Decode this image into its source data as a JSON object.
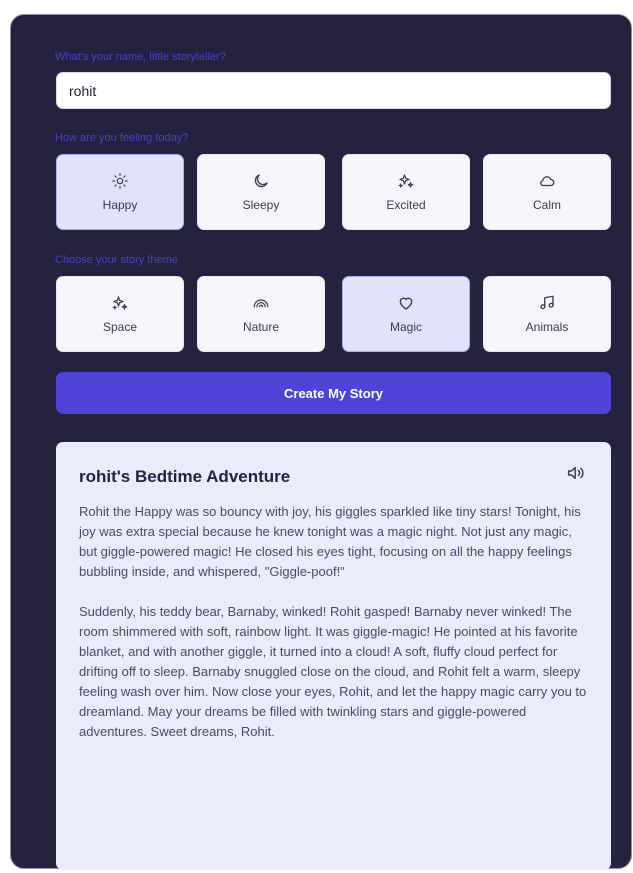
{
  "form": {
    "name_label": "What's your name, little storyteller?",
    "name_value": "rohit",
    "mood_label": "How are you feeling today?",
    "moods": [
      {
        "label": "Happy",
        "icon": "sun-icon",
        "selected": true
      },
      {
        "label": "Sleepy",
        "icon": "moon-icon",
        "selected": false
      },
      {
        "label": "Excited",
        "icon": "sparkles-icon",
        "selected": false
      },
      {
        "label": "Calm",
        "icon": "cloud-icon",
        "selected": false
      }
    ],
    "theme_label": "Choose your story theme",
    "themes": [
      {
        "label": "Space",
        "icon": "sparkles-icon",
        "selected": false
      },
      {
        "label": "Nature",
        "icon": "rainbow-icon",
        "selected": false
      },
      {
        "label": "Magic",
        "icon": "heart-icon",
        "selected": true
      },
      {
        "label": "Animals",
        "icon": "music-note-icon",
        "selected": false
      }
    ],
    "create_button": "Create My Story"
  },
  "story": {
    "title": "rohit's Bedtime Adventure",
    "speaker_icon": "speaker-icon",
    "paragraphs": [
      "Rohit the Happy was so bouncy with joy, his giggles sparkled like tiny stars! Tonight, his joy was extra special because he knew tonight was a magic night. Not just any magic, but giggle-powered magic! He closed his eyes tight, focusing on all the happy feelings bubbling inside, and whispered, \"Giggle-poof!\"",
      "Suddenly, his teddy bear, Barnaby, winked! Rohit gasped! Barnaby never winked! The room shimmered with soft, rainbow light. It was giggle-magic! He pointed at his favorite blanket, and with another giggle, it turned into a cloud! A soft, fluffy cloud perfect for drifting off to sleep. Barnaby snuggled close on the cloud, and Rohit felt a warm, sleepy feeling wash over him. Now close your eyes, Rohit, and let the happy magic carry you to dreamland. May your dreams be filled with twinkling stars and giggle-powered adventures. Sweet dreams, Rohit."
    ]
  },
  "colors": {
    "panel_bg": "#25223f",
    "accent": "#4f43d9",
    "label": "#4c3fc6",
    "selected_card": "#e0e3fb",
    "story_bg": "#e9ecfa"
  }
}
